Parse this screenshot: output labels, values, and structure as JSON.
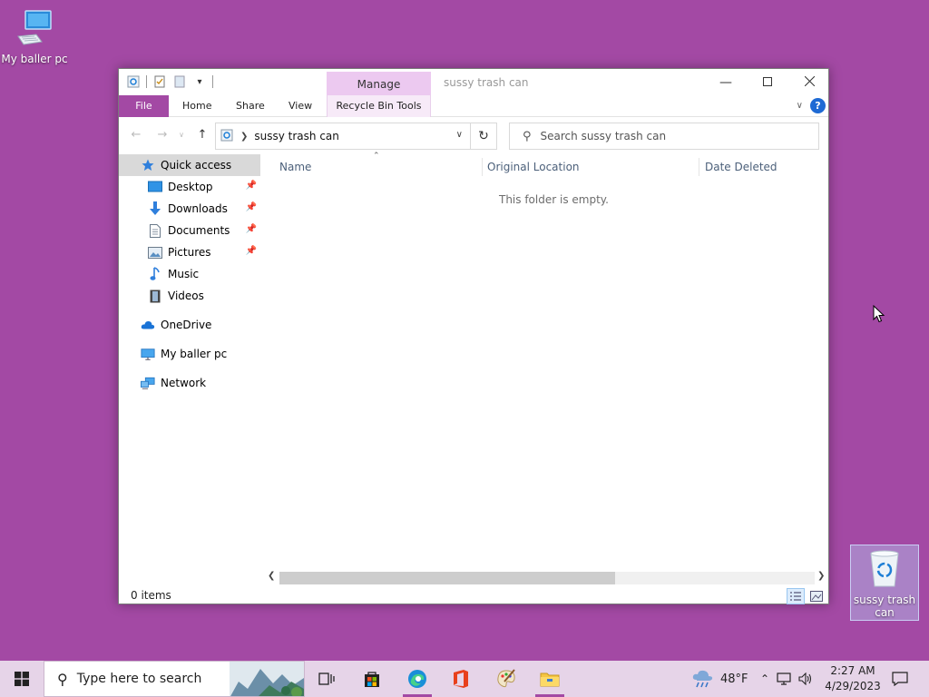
{
  "desktop": {
    "pc_label": "My baller pc",
    "bin_label": "sussy trash can"
  },
  "window": {
    "title": "sussy trash can",
    "context_tab_group": "Manage",
    "ribbon_tabs": [
      {
        "label": "File"
      },
      {
        "label": "Home"
      },
      {
        "label": "Share"
      },
      {
        "label": "View"
      },
      {
        "label": "Recycle Bin Tools"
      }
    ],
    "help_label": "?"
  },
  "navbar": {
    "breadcrumb": "sussy trash can",
    "search_placeholder": "Search sussy trash can"
  },
  "nav_pane": {
    "items": [
      {
        "label": "Quick access",
        "icon": "star-icon"
      },
      {
        "label": "Desktop",
        "icon": "desktop-folder-icon"
      },
      {
        "label": "Downloads",
        "icon": "download-arrow-icon"
      },
      {
        "label": "Documents",
        "icon": "document-icon"
      },
      {
        "label": "Pictures",
        "icon": "pictures-icon"
      },
      {
        "label": "Music",
        "icon": "music-note-icon"
      },
      {
        "label": "Videos",
        "icon": "film-icon"
      },
      {
        "label": "OneDrive",
        "icon": "cloud-icon"
      },
      {
        "label": "My baller pc",
        "icon": "computer-icon"
      },
      {
        "label": "Network",
        "icon": "network-icon"
      }
    ]
  },
  "content": {
    "columns": [
      "Name",
      "Original Location",
      "Date Deleted"
    ],
    "empty_message": "This folder is empty."
  },
  "status": {
    "item_count": "0 items"
  },
  "taskbar": {
    "search_text": "Type here to search",
    "weather": "48°F",
    "time": "2:27 AM",
    "date": "4/29/2023"
  },
  "colors": {
    "desktop_bg": "#a349a4",
    "accent": "#a349a4",
    "context_tab": "#ecc9f0",
    "taskbar_bg": "#e6d4e8"
  }
}
